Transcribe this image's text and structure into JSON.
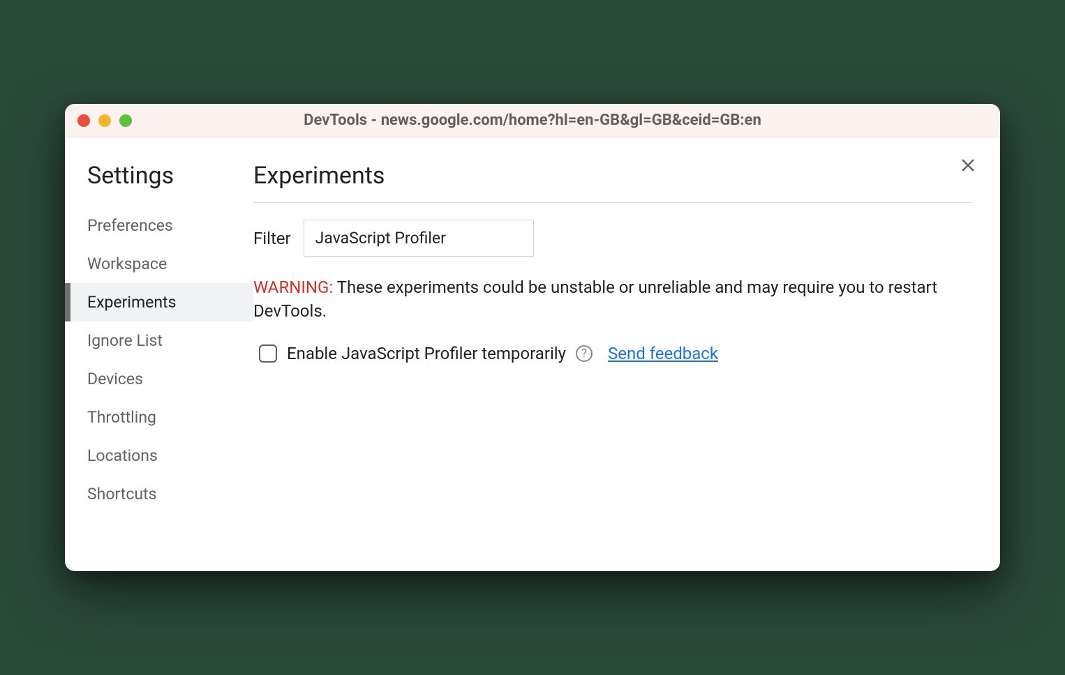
{
  "window": {
    "title": "DevTools - news.google.com/home?hl=en-GB&gl=GB&ceid=GB:en"
  },
  "sidebar": {
    "title": "Settings",
    "items": [
      {
        "label": "Preferences",
        "active": false
      },
      {
        "label": "Workspace",
        "active": false
      },
      {
        "label": "Experiments",
        "active": true
      },
      {
        "label": "Ignore List",
        "active": false
      },
      {
        "label": "Devices",
        "active": false
      },
      {
        "label": "Throttling",
        "active": false
      },
      {
        "label": "Locations",
        "active": false
      },
      {
        "label": "Shortcuts",
        "active": false
      }
    ]
  },
  "main": {
    "title": "Experiments",
    "filter_label": "Filter",
    "filter_value": "JavaScript Profiler",
    "warning_label": "WARNING:",
    "warning_text": " These experiments could be unstable or unreliable and may require you to restart DevTools.",
    "experiment": {
      "checked": false,
      "label": "Enable JavaScript Profiler temporarily",
      "help_glyph": "?",
      "feedback_label": "Send feedback"
    }
  }
}
